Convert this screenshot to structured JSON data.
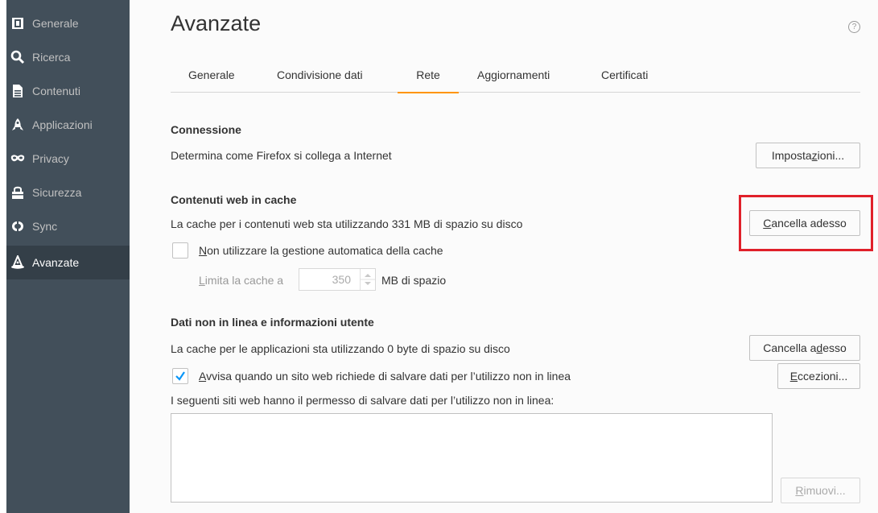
{
  "sidebar": {
    "items": [
      {
        "label": "Generale",
        "icon": "general-icon"
      },
      {
        "label": "Ricerca",
        "icon": "search-icon"
      },
      {
        "label": "Contenuti",
        "icon": "document-icon"
      },
      {
        "label": "Applicazioni",
        "icon": "rocket-icon"
      },
      {
        "label": "Privacy",
        "icon": "mask-icon"
      },
      {
        "label": "Sicurezza",
        "icon": "lock-icon"
      },
      {
        "label": "Sync",
        "icon": "sync-icon"
      },
      {
        "label": "Avanzate",
        "icon": "wizard-hat-icon"
      }
    ],
    "selected": "Avanzate"
  },
  "page": {
    "title": "Avanzate",
    "help_icon": "?"
  },
  "tabs": [
    {
      "label": "Generale"
    },
    {
      "label": "Condivisione dati"
    },
    {
      "label": "Rete"
    },
    {
      "label": "Aggiornamenti"
    },
    {
      "label": "Certificati"
    }
  ],
  "selected_tab": "Rete",
  "connection": {
    "heading": "Connessione",
    "description": "Determina come Firefox si collega a Internet",
    "settings_button": {
      "pre": "Imposta",
      "u": "z",
      "post": "ioni..."
    }
  },
  "web_cache": {
    "heading": "Contenuti web in cache",
    "description": "La cache per i contenuti web sta utilizzando 331 MB di spazio su disco",
    "clear_button": {
      "pre": "",
      "u": "C",
      "post": "ancella adesso"
    },
    "override_label": {
      "pre": "",
      "u": "N",
      "post": "on utilizzare la gestione automatica della cache"
    },
    "override_checked": false,
    "limit_label": {
      "pre": "",
      "u": "L",
      "post": "imita la cache a"
    },
    "limit_value": "350",
    "limit_unit": "MB di spazio"
  },
  "offline": {
    "heading": "Dati non in linea e informazioni utente",
    "description": "La cache per le applicazioni sta utilizzando 0 byte di spazio su disco",
    "clear_button": {
      "pre": "Cancella a",
      "u": "d",
      "post": "esso"
    },
    "notify_label": {
      "pre": "",
      "u": "A",
      "post": "vvisa quando un sito web richiede di salvare dati per l’utilizzo non in linea"
    },
    "notify_checked": true,
    "exceptions_button": {
      "pre": "",
      "u": "E",
      "post": "ccezioni..."
    },
    "allowed_sites_label": "I seguenti siti web hanno il permesso di salvare dati per l’utilizzo non in linea:",
    "remove_button": {
      "pre": "",
      "u": "R",
      "post": "imuovi..."
    }
  },
  "colors": {
    "sidebar_bg": "#424f5a",
    "sidebar_selected_bg": "#343f48",
    "tab_accent": "#ff9500",
    "checkbox_accent": "#0996f8",
    "highlight_box": "#e0202a"
  }
}
